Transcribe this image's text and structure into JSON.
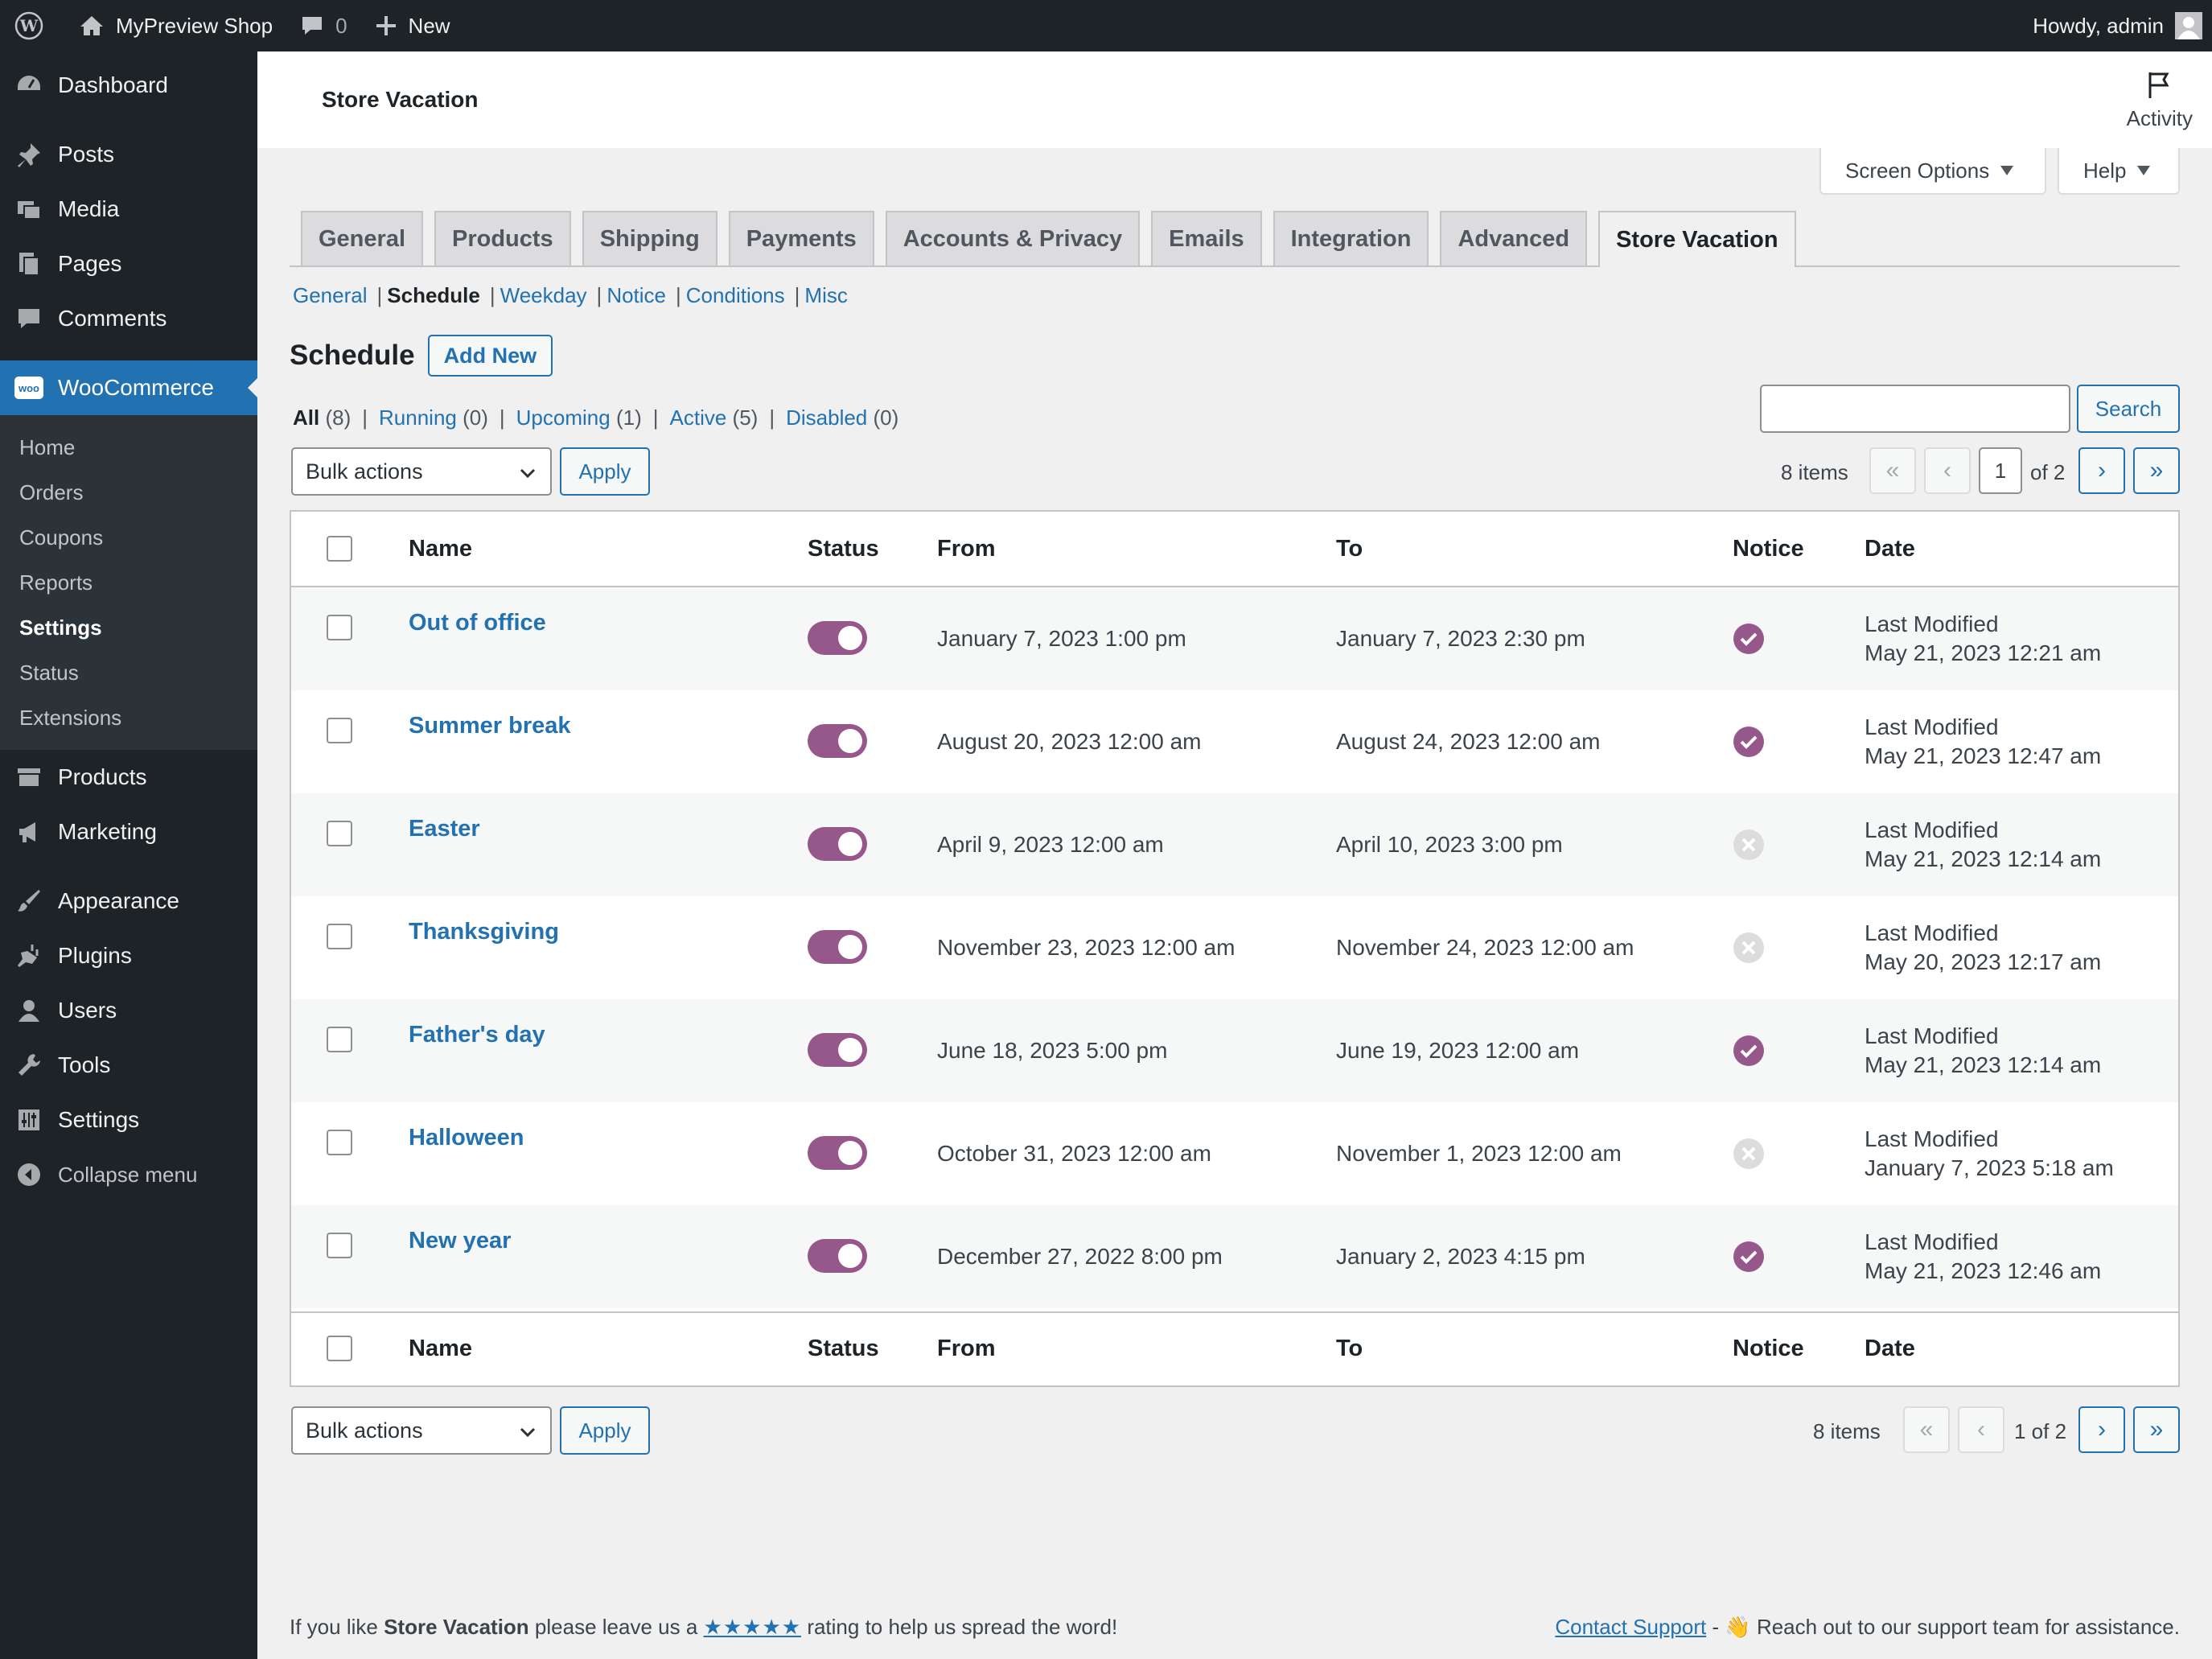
{
  "adminbar": {
    "site_name": "MyPreview Shop",
    "comments_count": "0",
    "new_label": "New",
    "howdy": "Howdy, admin"
  },
  "sidebar": {
    "top_items": [
      {
        "label": "Dashboard",
        "icon": "dashboard-icon"
      },
      {
        "label": "Posts",
        "icon": "pin-icon"
      },
      {
        "label": "Media",
        "icon": "media-icon"
      },
      {
        "label": "Pages",
        "icon": "pages-icon"
      },
      {
        "label": "Comments",
        "icon": "comment-icon"
      }
    ],
    "woocommerce": {
      "label": "WooCommerce",
      "icon_text": "woo"
    },
    "woo_sub": [
      "Home",
      "Orders",
      "Coupons",
      "Reports",
      "Settings",
      "Status",
      "Extensions"
    ],
    "mid_items": [
      {
        "label": "Products",
        "icon": "archive-icon"
      },
      {
        "label": "Marketing",
        "icon": "megaphone-icon"
      }
    ],
    "bottom_items": [
      {
        "label": "Appearance",
        "icon": "brush-icon"
      },
      {
        "label": "Plugins",
        "icon": "plugin-icon"
      },
      {
        "label": "Users",
        "icon": "user-icon"
      },
      {
        "label": "Tools",
        "icon": "wrench-icon"
      },
      {
        "label": "Settings",
        "icon": "sliders-icon"
      }
    ],
    "collapse": "Collapse menu"
  },
  "header": {
    "title": "Store Vacation",
    "activity": "Activity"
  },
  "screen_options": "Screen Options",
  "help": "Help",
  "tabs": [
    "General",
    "Products",
    "Shipping",
    "Payments",
    "Accounts & Privacy",
    "Emails",
    "Integration",
    "Advanced",
    "Store Vacation"
  ],
  "subnav": [
    "General",
    "Schedule",
    "Weekday",
    "Notice",
    "Conditions",
    "Misc"
  ],
  "schedule": {
    "heading": "Schedule",
    "add_new": "Add New"
  },
  "views": [
    {
      "label": "All",
      "count": "(8)"
    },
    {
      "label": "Running",
      "count": "(0)"
    },
    {
      "label": "Upcoming",
      "count": "(1)"
    },
    {
      "label": "Active",
      "count": "(5)"
    },
    {
      "label": "Disabled",
      "count": "(0)"
    }
  ],
  "search_button": "Search",
  "bulk_actions": "Bulk actions",
  "apply": "Apply",
  "pagination": {
    "items": "8 items",
    "current_page": "1",
    "of_total": "of 2",
    "bottom_text": "1 of 2",
    "first": "«",
    "prev": "‹",
    "next": "›",
    "last": "»"
  },
  "columns": [
    "Name",
    "Status",
    "From",
    "To",
    "Notice",
    "Date"
  ],
  "rows": [
    {
      "name": "Out of office",
      "from": "January 7, 2023 1:00 pm",
      "to": "January 7, 2023 2:30 pm",
      "notice": "on",
      "date_label": "Last Modified",
      "date": "May 21, 2023 12:21 am"
    },
    {
      "name": "Summer break",
      "from": "August 20, 2023 12:00 am",
      "to": "August 24, 2023 12:00 am",
      "notice": "on",
      "date_label": "Last Modified",
      "date": "May 21, 2023 12:47 am"
    },
    {
      "name": "Easter",
      "from": "April 9, 2023 12:00 am",
      "to": "April 10, 2023 3:00 pm",
      "notice": "off",
      "date_label": "Last Modified",
      "date": "May 21, 2023 12:14 am"
    },
    {
      "name": "Thanksgiving",
      "from": "November 23, 2023 12:00 am",
      "to": "November 24, 2023 12:00 am",
      "notice": "off",
      "date_label": "Last Modified",
      "date": "May 20, 2023 12:17 am"
    },
    {
      "name": "Father's day",
      "from": "June 18, 2023 5:00 pm",
      "to": "June 19, 2023 12:00 am",
      "notice": "on",
      "date_label": "Last Modified",
      "date": "May 21, 2023 12:14 am"
    },
    {
      "name": "Halloween",
      "from": "October 31, 2023 12:00 am",
      "to": "November 1, 2023 12:00 am",
      "notice": "off",
      "date_label": "Last Modified",
      "date": "January 7, 2023 5:18 am"
    },
    {
      "name": "New year",
      "from": "December 27, 2022 8:00 pm",
      "to": "January 2, 2023 4:15 pm",
      "notice": "on",
      "date_label": "Last Modified",
      "date": "May 21, 2023 12:46 am"
    }
  ],
  "footer": {
    "left_prefix": "If you like",
    "left_brand": "Store Vacation",
    "left_mid": "please leave us a",
    "stars": "★★★★★",
    "left_suffix": "rating to help us spread the word!",
    "contact": "Contact Support",
    "dash": " - ",
    "emoji": "👋",
    "right_text": "Reach out to our support team for assistance."
  },
  "colors": {
    "brand_purple": "#96588a",
    "wp_blue": "#2271b1",
    "sidebar_bg": "#1d2327",
    "notice_off": "#dcdcde"
  }
}
